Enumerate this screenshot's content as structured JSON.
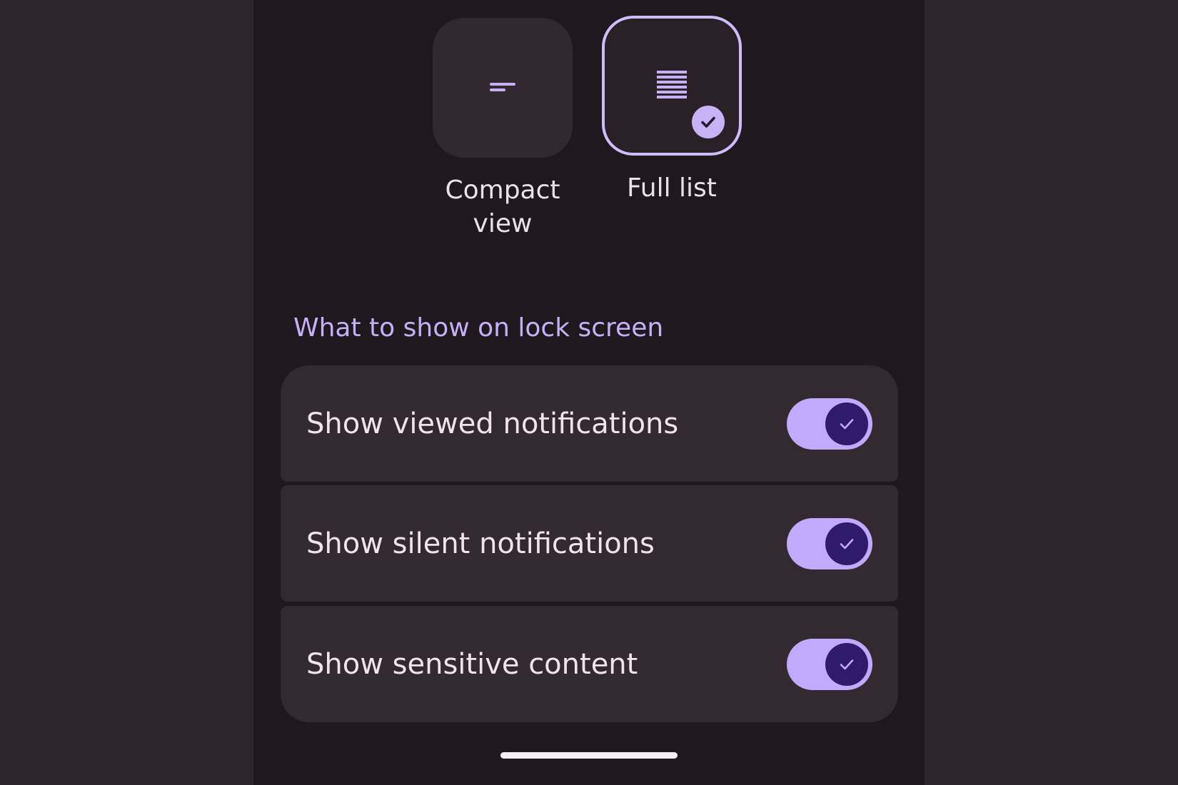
{
  "layout_options": [
    {
      "label": "Compact view",
      "icon": "compact-lines-icon",
      "selected": false
    },
    {
      "label": "Full list",
      "icon": "full-list-icon",
      "selected": true
    }
  ],
  "section": {
    "title": "What to show on lock screen"
  },
  "settings": [
    {
      "label": "Show viewed notifications",
      "enabled": true
    },
    {
      "label": "Show silent notifications",
      "enabled": true
    },
    {
      "label": "Show sensitive content",
      "enabled": true
    }
  ],
  "colors": {
    "accent": "#c8b0f6",
    "switch_track": "#c1a9fb",
    "switch_knob": "#2f1a6b",
    "surface": "#332930",
    "background": "#1f181e"
  }
}
